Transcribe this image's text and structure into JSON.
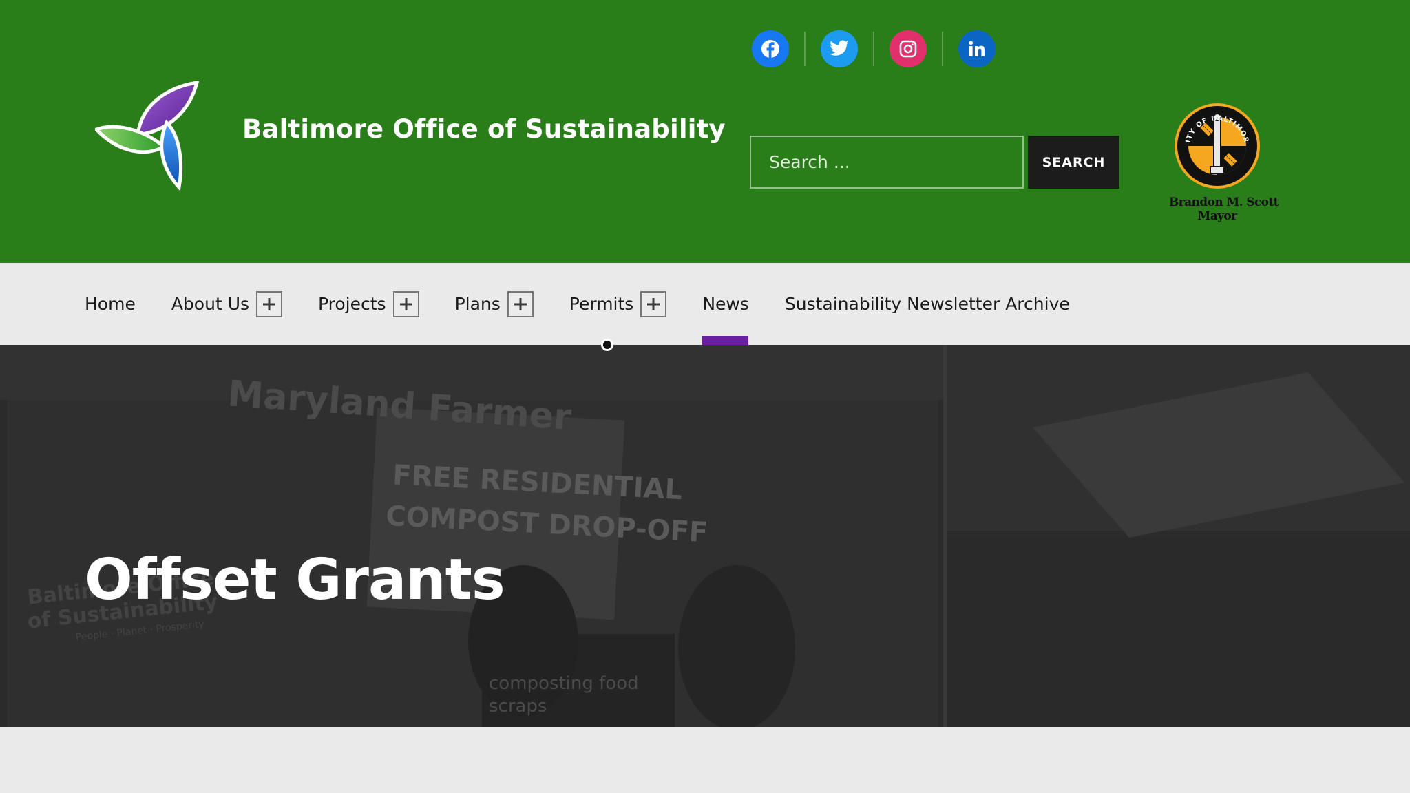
{
  "site": {
    "title": "Baltimore Office of Sustainability",
    "header_color": "#2a7e19"
  },
  "social": [
    {
      "name": "facebook",
      "icon": "facebook-icon",
      "glyph": "f",
      "color": "#1877f2"
    },
    {
      "name": "twitter",
      "icon": "twitter-icon",
      "glyph": "t",
      "color": "#1d9bf0"
    },
    {
      "name": "instagram",
      "icon": "instagram-icon",
      "glyph": "◎",
      "color": "#e1306c"
    },
    {
      "name": "linkedin",
      "icon": "linkedin-icon",
      "glyph": "in",
      "color": "#0a66c2"
    }
  ],
  "search": {
    "placeholder": "Search ...",
    "button_label": "SEARCH"
  },
  "mayor": {
    "name_line1": "Brandon M. Scott",
    "name_line2": "Mayor",
    "seal_text": "CITY OF BALTIMORE"
  },
  "nav": {
    "items": [
      {
        "label": "Home",
        "expandable": false
      },
      {
        "label": "About Us",
        "expandable": true
      },
      {
        "label": "Projects",
        "expandable": true
      },
      {
        "label": "Plans",
        "expandable": true
      },
      {
        "label": "Permits",
        "expandable": true
      },
      {
        "label": "News",
        "expandable": false,
        "active": true
      },
      {
        "label": "Sustainability Newsletter Archive",
        "expandable": false
      }
    ],
    "active_color": "#6a1fa0"
  },
  "hero": {
    "title": "Offset Grants",
    "photo_text": {
      "banner": "Maryland Farmer",
      "sign_line1": "FREE RESIDENTIAL",
      "sign_line2": "COMPOST DROP-OFF",
      "poster_line1": "composting food",
      "poster_line2": "scraps",
      "table_line1": "Baltimore Office",
      "table_line2": "of Sustainability",
      "table_line3": "People · Planet · Prosperity"
    }
  }
}
